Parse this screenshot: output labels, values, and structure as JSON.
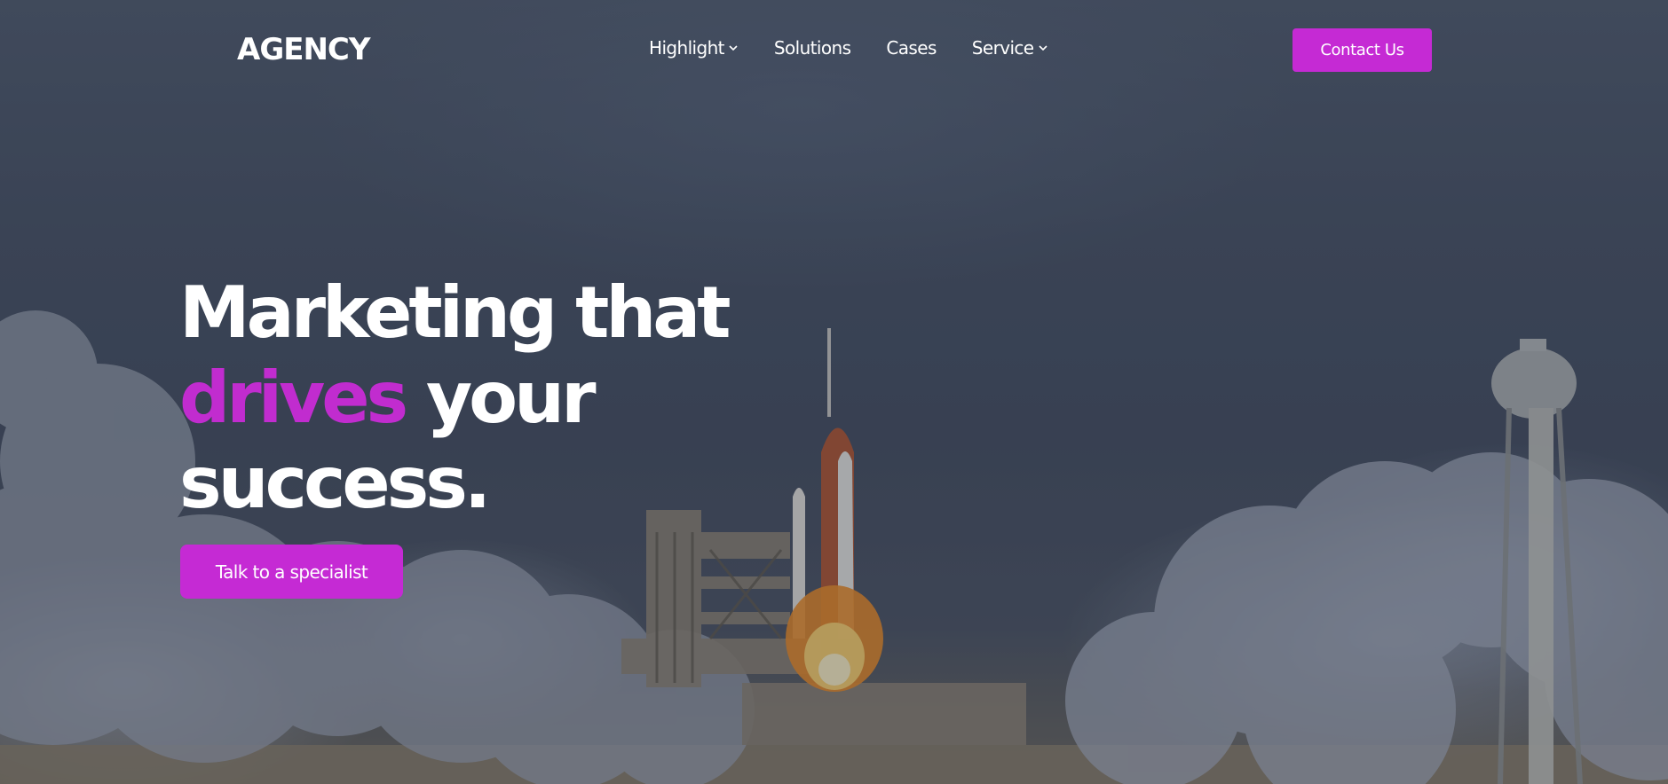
{
  "brand": {
    "logo_text": "AGENCY"
  },
  "nav": {
    "items": [
      {
        "label": "Highlight",
        "has_dropdown": true
      },
      {
        "label": "Solutions",
        "has_dropdown": false
      },
      {
        "label": "Cases",
        "has_dropdown": false
      },
      {
        "label": "Service",
        "has_dropdown": true
      }
    ],
    "contact_label": "Contact Us"
  },
  "hero": {
    "title_line1": "Marketing that",
    "title_accent": "drives",
    "title_line2_rest": " your",
    "title_line3": "success.",
    "cta_label": "Talk to a specialist",
    "background_image": "rocket-launch-photo"
  },
  "colors": {
    "accent": "#c52ad4",
    "text": "#ffffff",
    "overlay": "#3f485a"
  }
}
